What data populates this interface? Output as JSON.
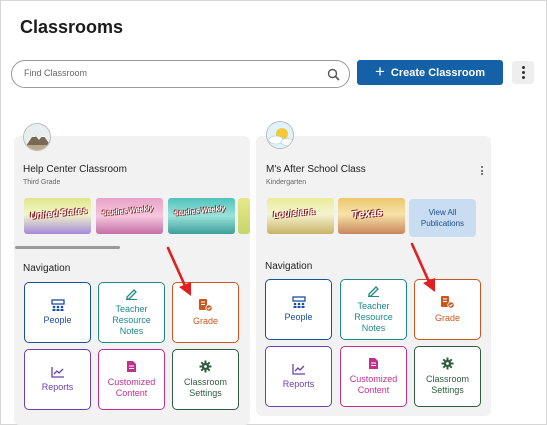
{
  "header": {
    "title": "Classrooms"
  },
  "search": {
    "placeholder": "Find Classroom"
  },
  "toolbar": {
    "create_label": "Create Classroom"
  },
  "colors": {
    "primary": "#1561a8",
    "card_bg": "#f2f2f2",
    "arrow": "#e02020"
  },
  "classrooms": [
    {
      "name": "Help Center Classroom",
      "grade": "Third Grade",
      "avatar_icon": "snow-mountain-avatar-icon",
      "publications": [
        "United States",
        "Studies Weekly",
        "Studies Weekly",
        ""
      ],
      "navigation_label": "Navigation",
      "tiles": [
        {
          "label": "People",
          "icon": "people-icon"
        },
        {
          "label": "Teacher Resource Notes",
          "icon": "pencil-note-icon"
        },
        {
          "label": "Grade",
          "icon": "grade-doc-check-icon"
        },
        {
          "label": "Reports",
          "icon": "line-chart-icon"
        },
        {
          "label": "Customized Content",
          "icon": "document-icon"
        },
        {
          "label": "Classroom Settings",
          "icon": "gear-icon"
        }
      ]
    },
    {
      "name": "M's After School Class",
      "grade": "Kindergarten",
      "avatar_icon": "sun-clouds-avatar-icon",
      "publications": [
        "Louisiana",
        "Texas"
      ],
      "view_all_label": "View All Publications",
      "navigation_label": "Navigation",
      "tiles": [
        {
          "label": "People",
          "icon": "people-icon"
        },
        {
          "label": "Teacher Resource Notes",
          "icon": "pencil-note-icon"
        },
        {
          "label": "Grade",
          "icon": "grade-doc-check-icon"
        },
        {
          "label": "Reports",
          "icon": "line-chart-icon"
        },
        {
          "label": "Customized Content",
          "icon": "document-icon"
        },
        {
          "label": "Classroom Settings",
          "icon": "gear-icon"
        }
      ]
    }
  ]
}
